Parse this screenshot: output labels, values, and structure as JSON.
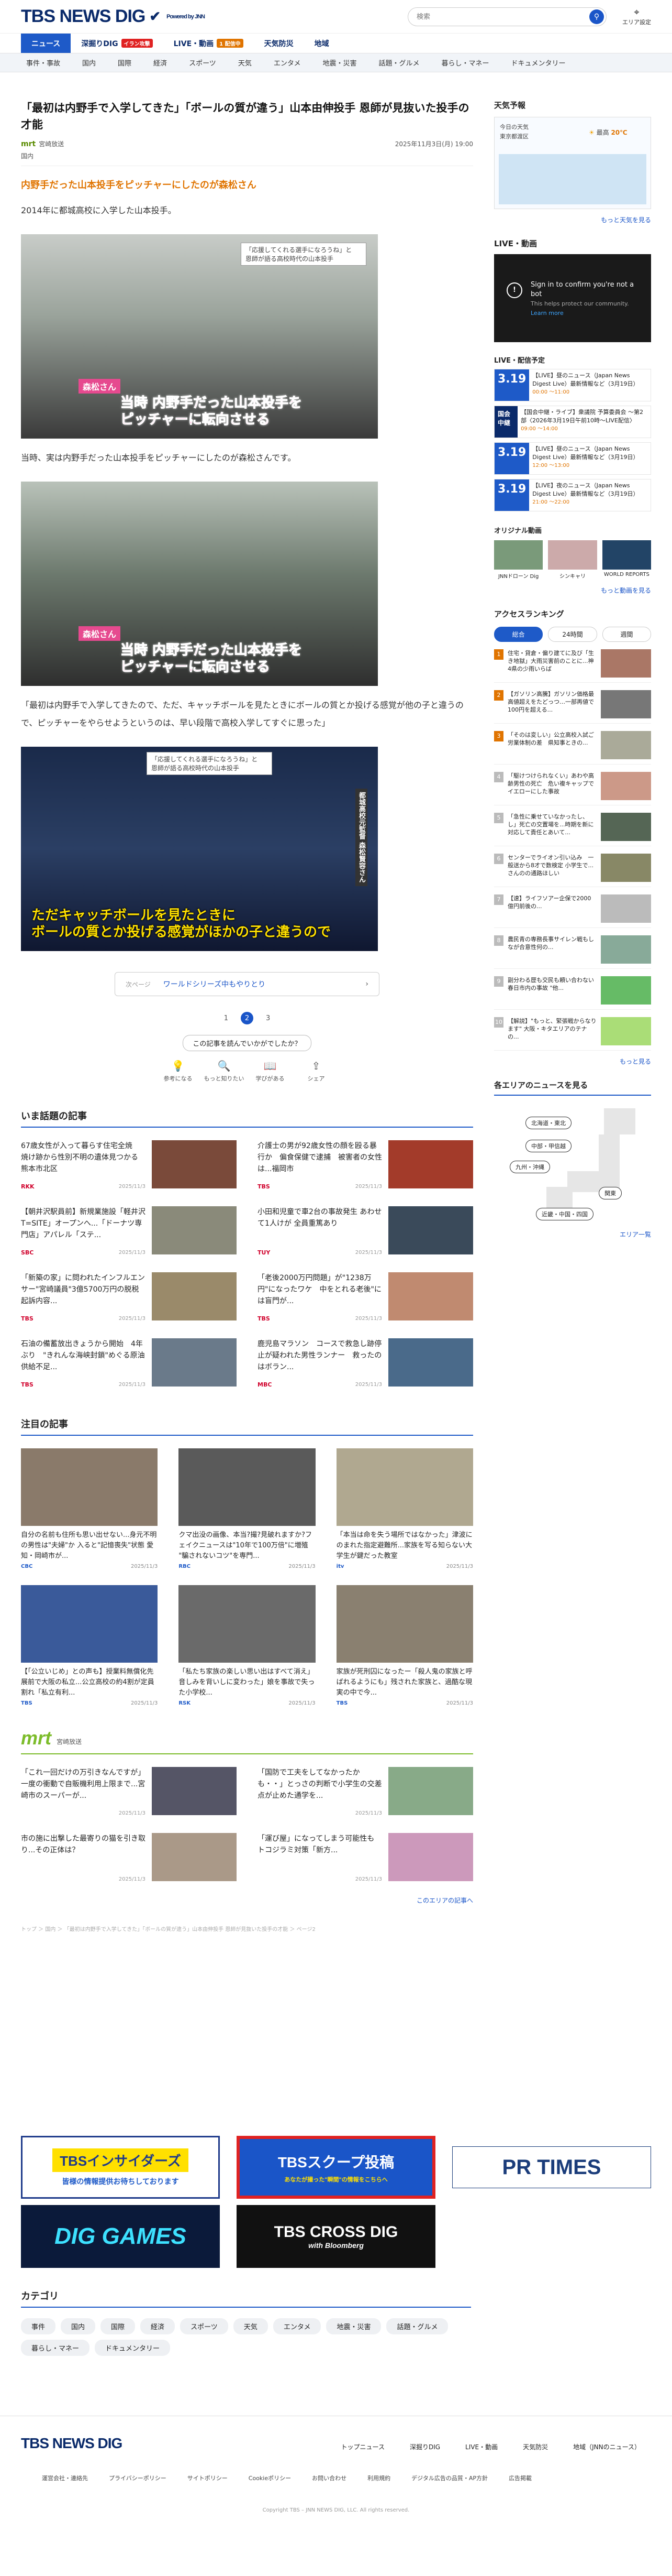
{
  "header": {
    "logo": "TBS NEWS DIG",
    "powered": "Powered by JNN",
    "search_placeholder": "検索",
    "area_label": "エリア設定"
  },
  "nav1": [
    {
      "label": "ニュース",
      "active": true
    },
    {
      "label": "深掘りDIG",
      "badge": "イラン攻撃",
      "badge_color": "#e02222"
    },
    {
      "label": "LIVE・動画",
      "badge": "1 配信中",
      "badge_color": "#e07400"
    },
    {
      "label": "天気防災"
    },
    {
      "label": "地域"
    }
  ],
  "nav2": [
    "事件・事故",
    "国内",
    "国際",
    "経済",
    "スポーツ",
    "天気",
    "エンタメ",
    "地震・災害",
    "話題・グルメ",
    "暮らし・マネー",
    "ドキュメンタリー"
  ],
  "article": {
    "title": "「最初は内野手で入学してきた」「ボールの質が違う」山本由伸投手 恩師が見抜いた投手の才能",
    "source": "宮崎放送",
    "source_logo": "mrt",
    "date": "2025年11月3日(月) 19:00",
    "category": "国内",
    "lead": "内野手だった山本投手をピッチャーにしたのが森松さん",
    "p1": "2014年に都城高校に入学した山本投手。",
    "p2": "当時、実は内野手だった山本投手をピッチャーにしたのが森松さんです。",
    "p3": "「最初は内野手で入学してきたので、ただ、キャッチボールを見たときにボールの質とか投げる感覚が他の子と違うので、ピッチャーをやらせようというのは、早い段階で高校入学してすぐに思った」",
    "photos": [
      {
        "caption": "当時 内野手だった山本投手を\nピッチャーに転向させる",
        "tag": "「応援してくれる選手になろうね」と\n恩師が語る高校時代の山本投手",
        "name": "森松さん",
        "style": "pink"
      },
      {
        "caption": "当時 内野手だった山本投手を\nピッチャーに転向させる",
        "tag": "",
        "name": "森松さん",
        "style": "pink"
      },
      {
        "caption": "ただキャッチボールを見たときに\nボールの質とか投げる感覚がほかの子と違うので",
        "tag": "「応援してくれる選手になろうね」と\n恩師が語る高校時代の山本投手",
        "name": "都城高校元監督 森松賢容さん",
        "style": "yellow"
      }
    ],
    "next_label": "次ページ",
    "next_title": "ワールドシリーズ中もやりとり",
    "pages": [
      "1",
      "2",
      "3"
    ],
    "current_page": "2",
    "feedback_q": "この記事を読んでいかがでしたか？",
    "feedback": [
      {
        "label": "参考になる",
        "icon": "bulb-icon",
        "glyph": "💡"
      },
      {
        "label": "もっと知りたい",
        "icon": "magnifier-icon",
        "glyph": "🔍"
      },
      {
        "label": "学びがある",
        "icon": "book-icon",
        "glyph": "📖"
      },
      {
        "label": "シェア",
        "icon": "share-icon",
        "glyph": "⇪"
      }
    ]
  },
  "hot": {
    "title": "いま話題の記事",
    "items": [
      {
        "text": "67歳女性が入って暮らす住宅全焼　焼け跡から性別不明の遺体見つかる　熊本市北区",
        "src": "RKK",
        "date": "2025/11/3"
      },
      {
        "text": "介護士の男が92歳女性の顔を殴る暴行か　偏食保健で逮捕　被害者の女性は...福岡市",
        "src": "TBS",
        "date": "2025/11/3"
      },
      {
        "text": "【朝井沢駅員前】新規業施設「軽井沢T=SITE」オープンへ...「ドーナツ専門店」アパレル「ステ...",
        "src": "SBC",
        "date": "2025/11/3"
      },
      {
        "text": "小田和児童で車2台の事故発生 あわせて1人けが 全員重篤あり",
        "src": "TUY",
        "date": "2025/11/3"
      },
      {
        "text": "「新築の家」に問われたインフルエンサー\"宮崎議員\"3億5700万円の脱税 起訴内容...",
        "src": "TBS",
        "date": "2025/11/3"
      },
      {
        "text": "「老後2000万円問題」が\"1238万円\"になったワケ　中をとれる老後\"には盲門が...",
        "src": "TBS",
        "date": "2025/11/3"
      },
      {
        "text": "石油の備蓄放出きょうから開始　4年ぶり　\"きれんな海峡封鎖\"めぐる原油供給不足...",
        "src": "TBS",
        "date": "2025/11/3"
      },
      {
        "text": "鹿児島マラソン　コースで救急し跡停止が疑われた男性ランナー　救ったのはボラン...",
        "src": "MBC",
        "date": "2025/11/3"
      }
    ]
  },
  "attention": {
    "title": "注目の記事",
    "items": [
      {
        "text": "自分の名前も住所も思い出せない...身元不明の男性は\"夫婦\"か 入ると\"記憶喪失\"状態 愛知・岡崎市が...",
        "src": "CBC",
        "date": "2025/11/3"
      },
      {
        "text": "クマ出没の画像、本当?撮?見破れますか?フェイクニュースは\"10年で100万倍\"に増殖 \"騙されないコツ\"を専門...",
        "src": "RBC",
        "date": "2025/11/3"
      },
      {
        "text": "「本当は命を失う場所ではなかった」津波にのまれた指定避難所...家族を写る知らない大学生が鍵だった教室",
        "src": "itv",
        "date": "2025/11/3"
      },
      {
        "text": "【「公立いじめ」との声も】授業料無償化先展前で大阪の私立...公立高校の約4割が定員割れ「私立有利...",
        "src": "TBS",
        "date": "2025/11/3"
      },
      {
        "text": "「私たち家族の楽しい思い出はすべて消え」音しみを背いしに変わった」娘を事故で失った小学校...",
        "src": "RSK",
        "date": "2025/11/3"
      },
      {
        "text": "家族が死刑囚になったー「殺人鬼の家族と呼ばれるようにも」残された家族と、過酷な現実の中で今...",
        "src": "TBS",
        "date": "2025/11/3"
      }
    ]
  },
  "mrt": {
    "logo": "mrt",
    "name": "宮崎放送",
    "items": [
      {
        "text": "「これ一回だけの万引きなんですが」一度の衝動で自販機利用上限まで...宮崎市のスーパーが...",
        "date": "2025/11/3"
      },
      {
        "text": "「国防で工夫をしてなかったかも・・」とっさの判断で小学生の交差点が止めた通学を...",
        "date": "2025/11/3"
      },
      {
        "text": "市の施に出撃した最寄りの猫を引き取り...その正体は？",
        "date": "2025/11/3"
      },
      {
        "text": "「運び屋」になってしまう可能性も トコジラミ対策「新方...",
        "date": "2025/11/3"
      }
    ],
    "more": "このエリアの記事へ"
  },
  "breadcrumb": "トップ ＞ 国内 ＞ 「最初は内野手で入学してきた」「ボールの質が違う」山本由伸投手 恩師が見抜いた投手の才能 ＞ ページ2",
  "banners": [
    {
      "label": "TBSインサイダーズ",
      "sub": "皆様の情報提供お待ちしております"
    },
    {
      "label": "TBSスクープ投稿",
      "sub": "あなたが撮った\"瞬間\"の情報をこちらへ"
    },
    {
      "label": "PR TIMES",
      "sub": ""
    },
    {
      "label": "DIG GAMES",
      "sub": ""
    },
    {
      "label": "TBS CROSS DIG",
      "sub": "with Bloomberg"
    }
  ],
  "categories": {
    "title": "カテゴリ",
    "items": [
      "事件",
      "国内",
      "国際",
      "経済",
      "スポーツ",
      "天気",
      "エンタメ",
      "地震・災害",
      "話題・グルメ",
      "暮らし・マネー",
      "ドキュメンタリー"
    ]
  },
  "footer": {
    "logo": "TBS NEWS DIG",
    "links": [
      "トップニュース",
      "深掘りDIG",
      "LIVE・動画",
      "天気防災",
      "地域（JNNのニュース）"
    ],
    "links2": [
      "運営会社・連絡先",
      "プライバシーポリシー",
      "サイトポリシー",
      "Cookieポリシー",
      "お問い合わせ",
      "利用規約",
      "デジタル広告の品質・AP方針",
      "広告掲載"
    ],
    "copyright": "Copyright TBS – JNN NEWS DIG, LLC. All rights reserved."
  },
  "side": {
    "weather": {
      "title": "天気予報",
      "loc": "今日の天気\n東京都渡区",
      "high": "最高",
      "high_val": "20℃",
      "low_val": "—",
      "more": "もっと天気を見る"
    },
    "live": {
      "title": "LIVE・動画",
      "video_msg": "Sign in to confirm you're not a bot",
      "video_sub": "This helps protect our community.",
      "learn": "Learn more",
      "mark": "!"
    },
    "schedule": {
      "title": "LIVE・配信予定",
      "items": [
        {
          "date": "3.19",
          "text": "【LIVE】昼のニュース（Japan News Digest Live）最新情報など（3月19日）",
          "time": "00:00 ～11:00"
        },
        {
          "date": "国会中継",
          "text": "【国会中継・ライブ】衆議院 予算委員会 ～第2部〈2026年3月19日午前10時〜LIVE配信〉",
          "time": "09:00 ～14:00"
        },
        {
          "date": "3.19",
          "text": "【LIVE】昼のニュース（Japan News Digest Live）最新情報など（3月19日）",
          "time": "12:00 ～13:00"
        },
        {
          "date": "3.19",
          "text": "【LIVE】夜のニュース（Japan News Digest Live）最新情報など（3月19日）",
          "time": "21:00 ～22:00"
        }
      ]
    },
    "original": {
      "title": "オリジナル動画",
      "items": [
        "JNNドローン Dig",
        "シンキャリ",
        "WORLD REPORTS"
      ],
      "more": "もっと動画を見る"
    },
    "ranking": {
      "title": "アクセスランキング",
      "tabs": [
        "総合",
        "24時間",
        "週間"
      ],
      "items": [
        {
          "n": "1",
          "text": "住宅・貸倉・偏り建てに及び「生き地獄」大雨災害前のことに...神4県の少雨いらば"
        },
        {
          "n": "2",
          "text": "【ガソリン高騰】ガソリン価格最高値超えをたどっつ…一部再値で100円を超える..."
        },
        {
          "n": "3",
          "text": "「そのは変しい」公立高校入試ご労業体制の差　県知事ときの..."
        },
        {
          "n": "4",
          "text": "「駆けつけられなくい」あわや高齢男性の死亡　危い複キャップでイエローにした事故"
        },
        {
          "n": "5",
          "text": "「急性に乗せていなかったし、し」死亡の交置場を...時期を新に対応して責任とあいて..."
        },
        {
          "n": "6",
          "text": "センターでライオン引い込み　一般送から8才で数検定 小学生で...さんのの通路ほしい"
        },
        {
          "n": "7",
          "text": "【速】ライフソアー企保で2000億円前後の..."
        },
        {
          "n": "8",
          "text": "農民青の専務長事サイレン戦もしなが合意性何の..."
        },
        {
          "n": "9",
          "text": "副分わる歴も交民も頼い合わない　春日市内の事故 \"他..."
        },
        {
          "n": "10",
          "text": "【解説】\"もっと、緊張戦からなります\" 大阪・キタエリアのテナの..."
        }
      ],
      "more": "もっと見る"
    },
    "areas": {
      "title": "各エリアのニュースを見る",
      "buttons": [
        "北海道・東北",
        "中部・甲信越",
        "九州・沖縄",
        "関東",
        "近畿・中国・四国"
      ],
      "more": "エリア一覧"
    }
  }
}
